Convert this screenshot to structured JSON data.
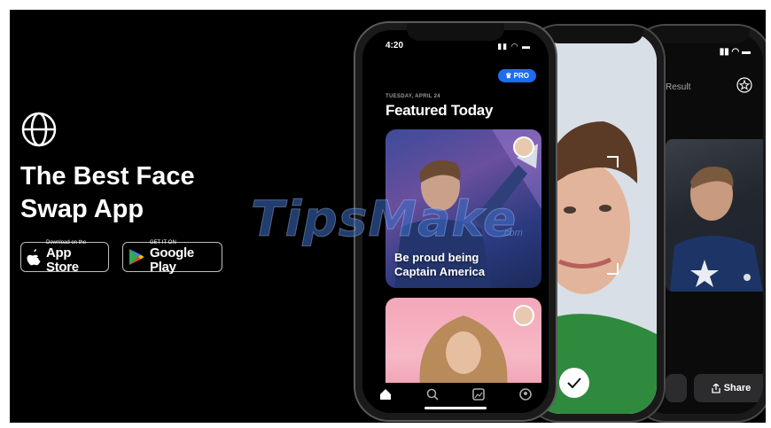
{
  "hero": {
    "headline_line1": "The Best Face",
    "headline_line2": "Swap App"
  },
  "store_buttons": {
    "apple_small": "Download on the",
    "apple_big": "App Store",
    "google_small": "GET IT ON",
    "google_big": "Google Play"
  },
  "watermark": {
    "text": "TipsMake",
    "sub": ".com"
  },
  "front_phone": {
    "time": "4:20",
    "pro_label": "♛ PRO",
    "date": "TUESDAY, APRIL 24",
    "heading": "Featured Today",
    "card1_caption_line1": "Be proud being",
    "card1_caption_line2": "Captain America",
    "tabs": [
      "home-icon",
      "search-icon",
      "gallery-icon",
      "profile-icon"
    ]
  },
  "back_phone": {
    "title": "Result",
    "share_label": "Share"
  },
  "colors": {
    "background": "#000000",
    "accent": "#1d6cf2"
  }
}
